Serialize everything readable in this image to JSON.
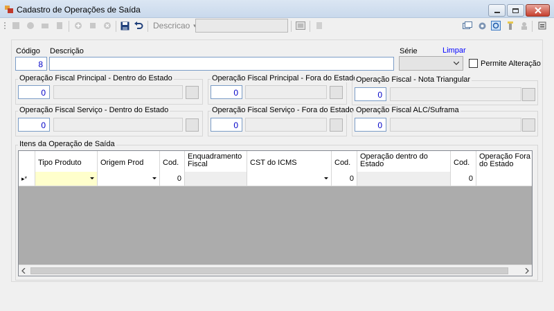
{
  "window": {
    "title": "Cadastro de Operações de Saída",
    "controls": {
      "minimize_icon": "minimize-icon",
      "maximize_icon": "maximize-icon",
      "close_icon": "close-icon"
    }
  },
  "toolbar": {
    "search_dropdown_label": "Descricao",
    "search_value": ""
  },
  "form": {
    "codigo_label": "Código",
    "codigo_value": "8",
    "descricao_label": "Descrição",
    "descricao_value": "",
    "serie_label": "Série",
    "serie_value": "",
    "limpar_label": "Limpar",
    "permite_label": "Permite Alteração",
    "permite_checked": false
  },
  "groups": [
    {
      "title": "Operação Fiscal Principal - Dentro do Estado",
      "code": "0",
      "desc": ""
    },
    {
      "title": "Operação Fiscal Principal - Fora do Estado",
      "code": "0",
      "desc": ""
    },
    {
      "title": "Operação Fiscal - Nota Triangular",
      "code": "0",
      "desc": ""
    },
    {
      "title": "Operação Fiscal Serviço - Dentro do Estado",
      "code": "0",
      "desc": ""
    },
    {
      "title": "Operação Fiscal Serviço - Fora do Estado",
      "code": "0",
      "desc": ""
    },
    {
      "title": "Operação Fiscal ALC/Suframa",
      "code": "0",
      "desc": ""
    }
  ],
  "items": {
    "title": "Itens da Operação de Saída",
    "columns": [
      "Tipo Produto",
      "Origem Prod",
      "Cod.",
      "Enquadramento Fiscal",
      "CST do ICMS",
      "Cod.",
      "Operação dentro do Estado",
      "Cod.",
      "Operação Fora do Estado"
    ],
    "new_row": {
      "marker": "▸*",
      "tipo_produto": "",
      "origem_prod": "",
      "cod1": "0",
      "enquadramento": "",
      "cst_icms": "",
      "cod2": "0",
      "op_dentro": "",
      "cod3": "0",
      "op_fora": ""
    }
  },
  "colors": {
    "highlight_cell": "#ffffcc",
    "grid_bg": "#acacac",
    "number_blue": "#0000c8"
  }
}
